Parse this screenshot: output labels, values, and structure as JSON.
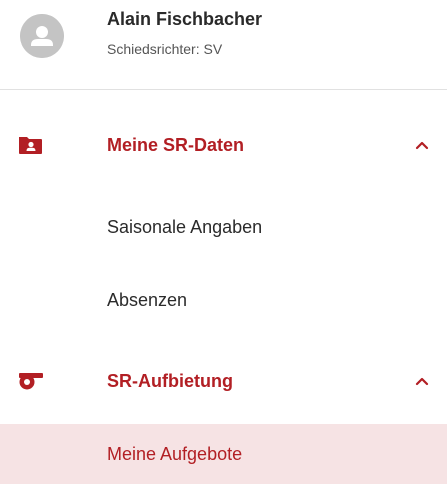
{
  "profile": {
    "name": "Alain Fischbacher",
    "role": "Schiedsrichter: SV"
  },
  "menu": {
    "groups": [
      {
        "label": "Meine SR-Daten",
        "icon": "folder-person-icon",
        "expanded": true,
        "items": [
          {
            "label": "Saisonale Angaben",
            "active": false
          },
          {
            "label": "Absenzen",
            "active": false
          }
        ]
      },
      {
        "label": "SR-Aufbietung",
        "icon": "whistle-icon",
        "expanded": true,
        "items": [
          {
            "label": "Meine Aufgebote",
            "active": true
          }
        ]
      }
    ]
  },
  "colors": {
    "accent": "#b21f24",
    "active_background": "#f6e3e4",
    "avatar": "#c4c4c4",
    "divider": "#e1e1e1"
  }
}
